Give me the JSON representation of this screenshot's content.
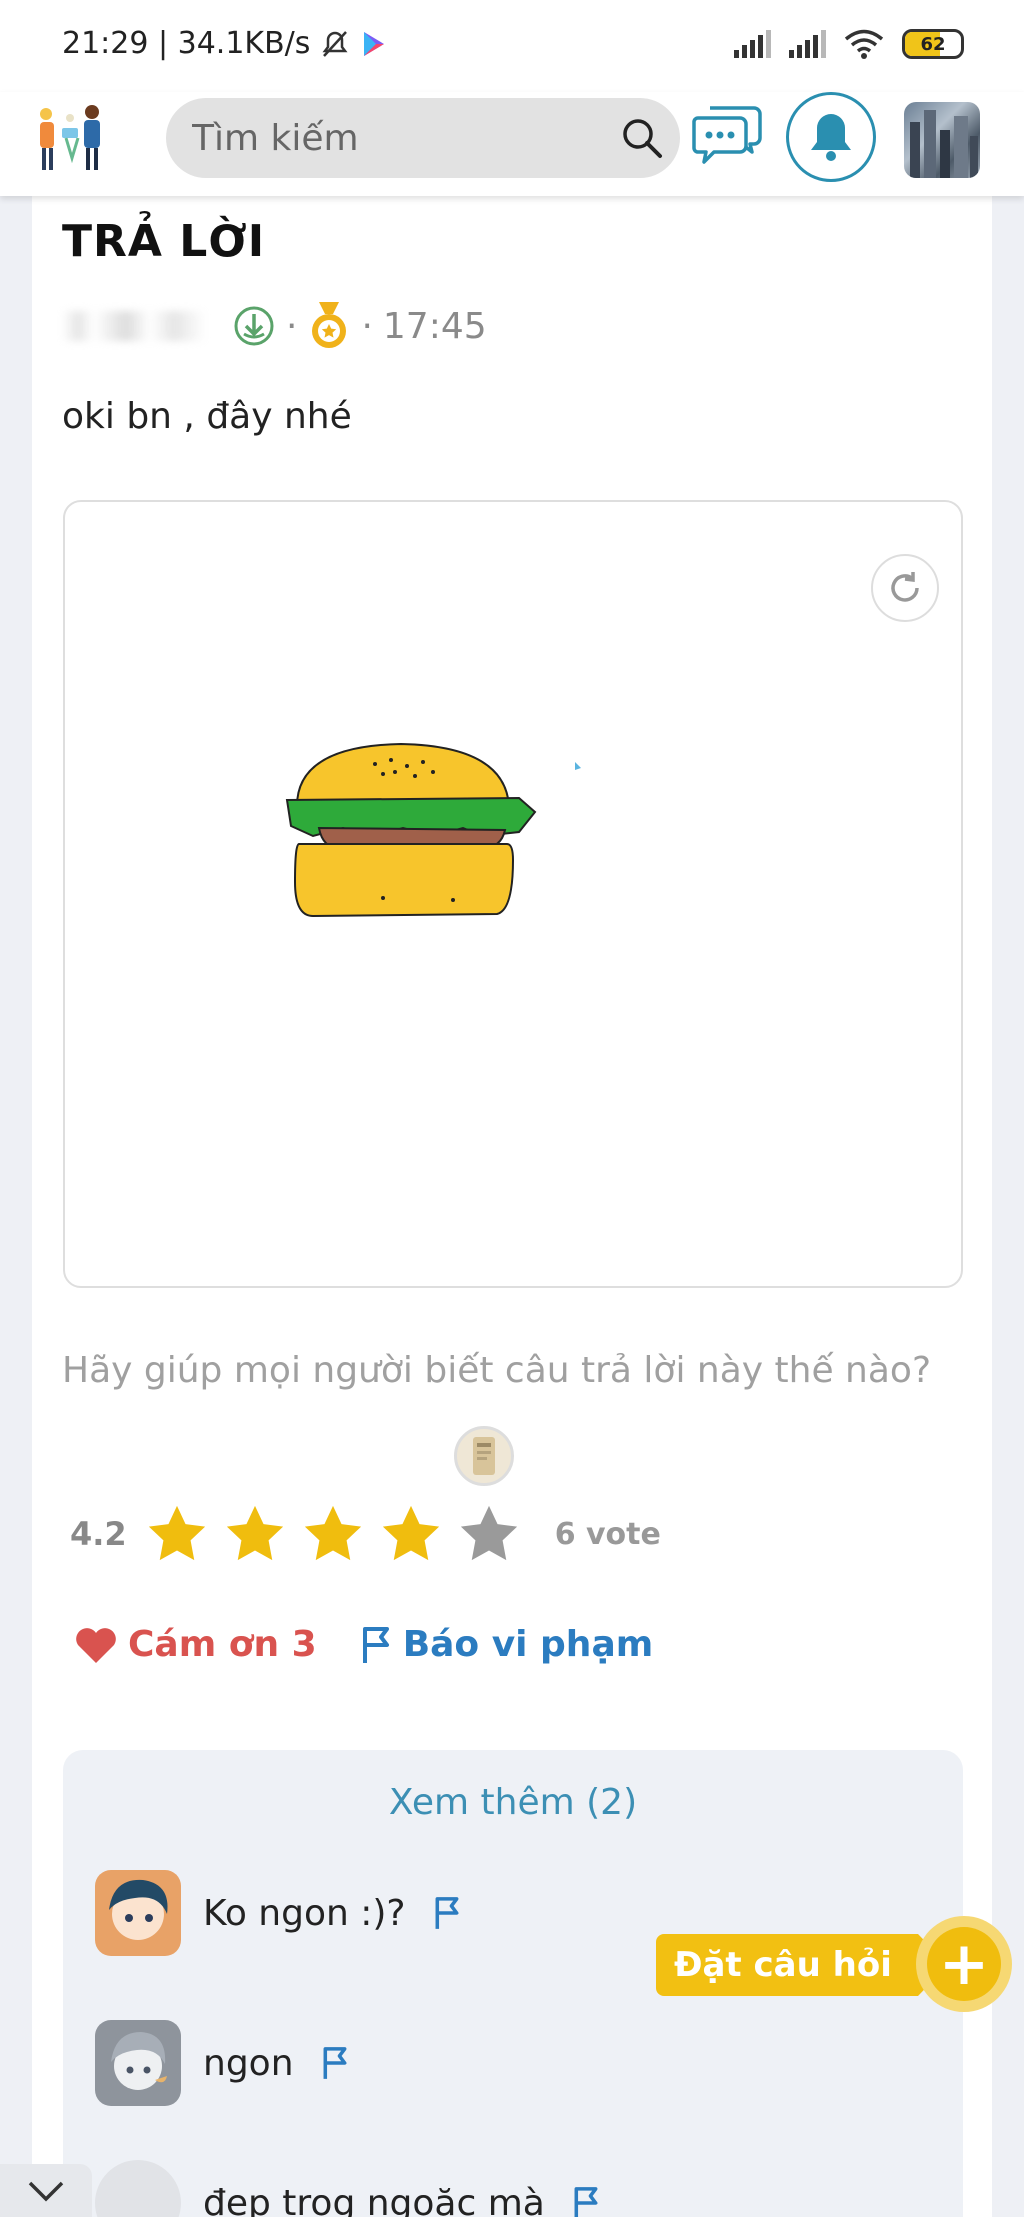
{
  "status_bar": {
    "time_speed": "21:29 | 34.1KB/s",
    "battery": "62",
    "battery_level": 0.62
  },
  "header": {
    "search_placeholder": "Tìm kiếm"
  },
  "answer": {
    "section_title": "TRẢ LỜI",
    "time": "17:45",
    "text": "oki bn , đây nhé",
    "rating_prompt": "Hãy giúp mọi người biết câu trả lời này thế nào?",
    "rating_value": "4.2",
    "stars_filled": 4,
    "stars_total": 5,
    "vote_count": "6 vote",
    "thanks_label": "Cám ơn 3",
    "report_label": "Báo vi phạm"
  },
  "comments": {
    "see_more_label": "Xem thêm (2)",
    "items": [
      {
        "text": "Ko ngon :)?"
      },
      {
        "text": "ngon"
      },
      {
        "text": "đẹp trog ngoặc mà"
      }
    ]
  },
  "fab": {
    "ask_label": "Đặt câu hỏi",
    "plus": "+"
  },
  "colors": {
    "accent_blue": "#2b7cc0",
    "thanks_red": "#d9534f",
    "star_gold": "#f0bd0e",
    "fab_yellow": "#f2c012"
  }
}
